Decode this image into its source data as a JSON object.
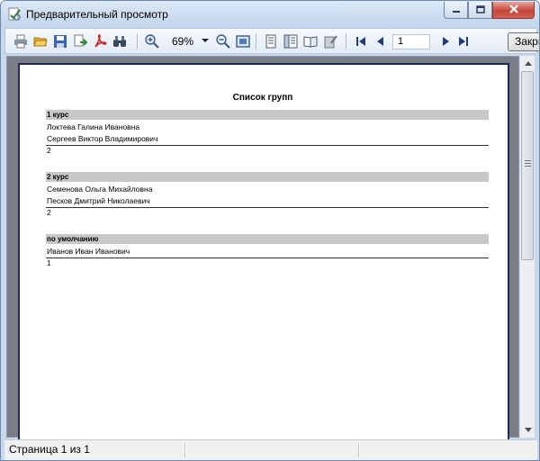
{
  "window": {
    "title": "Предварительный просмотр"
  },
  "toolbar": {
    "zoom": "69%",
    "page_number": "1",
    "close_label": "Закрыть"
  },
  "report": {
    "title": "Список групп",
    "groups": [
      {
        "name": "1 курс",
        "members": [
          "Локтева Галина Ивановна",
          "Сергеев Виктор Владимирович"
        ],
        "count": "2"
      },
      {
        "name": "2 курс",
        "members": [
          "Семенова Ольга Михайловна",
          "Песков Дмитрий Николаевич"
        ],
        "count": "2"
      },
      {
        "name": "по умолчанию",
        "members": [
          "Иванов Иван Иванович"
        ],
        "count": "1"
      }
    ]
  },
  "statusbar": {
    "page_info": "Страница 1 из 1"
  },
  "colors": {
    "titlebar": "#c2d5ec",
    "close": "#c7453a",
    "page_border": "#1e2d57",
    "preview_bg": "#7b7d86",
    "group_header": "#c8c8c8"
  }
}
